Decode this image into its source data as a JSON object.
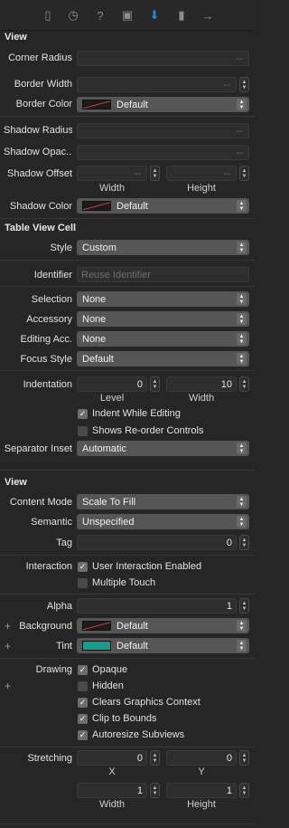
{
  "tabs": [
    {
      "name": "file-inspector-icon",
      "glyph": "▯"
    },
    {
      "name": "history-inspector-icon",
      "glyph": "◷"
    },
    {
      "name": "quick-help-icon",
      "glyph": "?"
    },
    {
      "name": "identity-inspector-icon",
      "glyph": "▣"
    },
    {
      "name": "attributes-inspector-icon",
      "glyph": "⬇"
    },
    {
      "name": "size-inspector-icon",
      "glyph": "▮"
    },
    {
      "name": "connections-inspector-icon",
      "glyph": "→"
    }
  ],
  "view1": {
    "title": "View",
    "corner_radius": "Corner Radius",
    "border_width": "Border Width",
    "border_color": "Border Color",
    "border_color_value": "Default",
    "shadow_radius": "Shadow Radius",
    "shadow_opacity": "Shadow Opac...",
    "shadow_offset": "Shadow Offset",
    "width": "Width",
    "height": "Height",
    "shadow_color": "Shadow Color",
    "shadow_color_value": "Default",
    "dashes": "--"
  },
  "cell": {
    "title": "Table View Cell",
    "style": "Style",
    "style_value": "Custom",
    "identifier": "Identifier",
    "identifier_placeholder": "Reuse Identifier",
    "selection": "Selection",
    "selection_value": "None",
    "accessory": "Accessory",
    "accessory_value": "None",
    "editing_acc": "Editing Acc.",
    "editing_acc_value": "None",
    "focus_style": "Focus Style",
    "focus_style_value": "Default",
    "indentation": "Indentation",
    "level_value": "0",
    "width_value": "10",
    "level": "Level",
    "width": "Width",
    "indent_while_editing": "Indent While Editing",
    "shows_reorder": "Shows Re-order Controls",
    "separator_inset": "Separator Inset",
    "separator_inset_value": "Automatic"
  },
  "view2": {
    "title": "View",
    "content_mode": "Content Mode",
    "content_mode_value": "Scale To Fill",
    "semantic": "Semantic",
    "semantic_value": "Unspecified",
    "tag": "Tag",
    "tag_value": "0",
    "interaction": "Interaction",
    "user_interaction": "User Interaction Enabled",
    "multiple_touch": "Multiple Touch",
    "alpha": "Alpha",
    "alpha_value": "1",
    "background": "Background",
    "background_value": "Default",
    "tint": "Tint",
    "tint_value": "Default",
    "drawing": "Drawing",
    "opaque": "Opaque",
    "hidden": "Hidden",
    "clears_graphics": "Clears Graphics Context",
    "clip_to_bounds": "Clip to Bounds",
    "autoresize": "Autoresize Subviews",
    "stretching": "Stretching",
    "x_value": "0",
    "y_value": "0",
    "w_value": "1",
    "h_value": "1",
    "x": "X",
    "y": "Y",
    "width": "Width",
    "height": "Height"
  },
  "colors": {
    "background": "#262626",
    "accent": "#2f83e0",
    "tint_swatch": "#1a9b8c"
  }
}
